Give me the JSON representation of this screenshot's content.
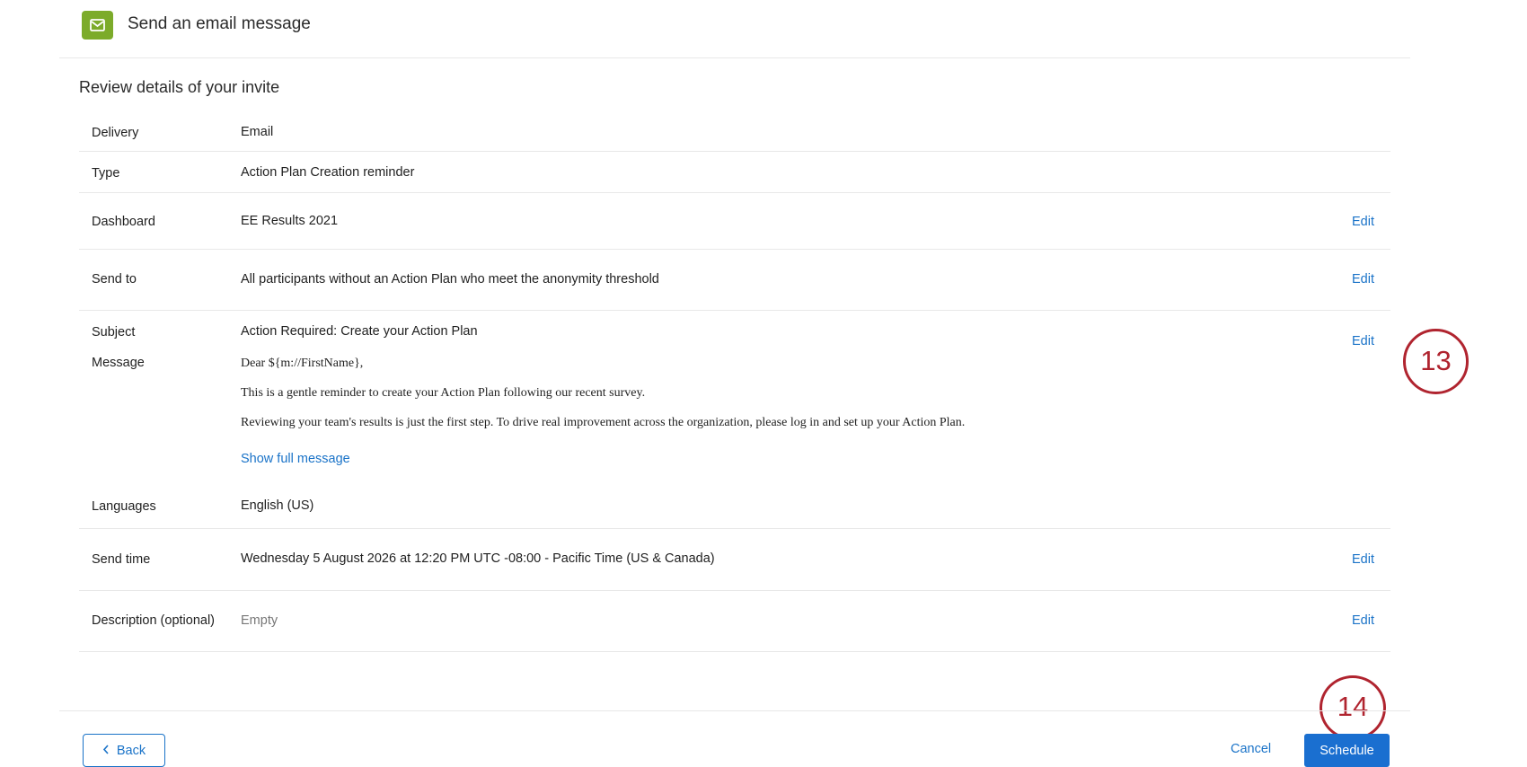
{
  "header": {
    "title": "Send an email message",
    "icon": "mail-icon",
    "icon_color": "#7cab2a"
  },
  "review": {
    "title": "Review details of your invite"
  },
  "rows": {
    "delivery": {
      "label": "Delivery",
      "value": "Email"
    },
    "type": {
      "label": "Type",
      "value": "Action Plan Creation reminder"
    },
    "dashboard": {
      "label": "Dashboard",
      "value": "EE Results 2021",
      "edit": "Edit"
    },
    "send_to": {
      "label": "Send to",
      "value": "All participants without an Action Plan who meet the anonymity threshold",
      "edit": "Edit"
    },
    "subject": {
      "label": "Subject",
      "value": "Action Required: Create your Action Plan",
      "edit": "Edit"
    },
    "message": {
      "label": "Message",
      "line1": "Dear ${m://FirstName},",
      "line2": "This is a gentle reminder to create your Action Plan following our recent survey.",
      "line3": "Reviewing your team's results is just the first step. To drive real improvement across the organization, please log in and set up your Action Plan.",
      "show_full": "Show full message"
    },
    "languages": {
      "label": "Languages",
      "value": "English (US)"
    },
    "send_time": {
      "label": "Send time",
      "value": "Wednesday 5 August 2026 at 12:20 PM UTC -08:00 - Pacific Time (US & Canada)",
      "edit": "Edit"
    },
    "description": {
      "label": "Description (optional)",
      "value": "Empty",
      "edit": "Edit"
    }
  },
  "callouts": {
    "c13": "13",
    "c14": "14"
  },
  "footer": {
    "back": "Back",
    "cancel": "Cancel",
    "schedule": "Schedule"
  },
  "colors": {
    "accent": "#1a73c8",
    "callout": "#b0242f"
  }
}
